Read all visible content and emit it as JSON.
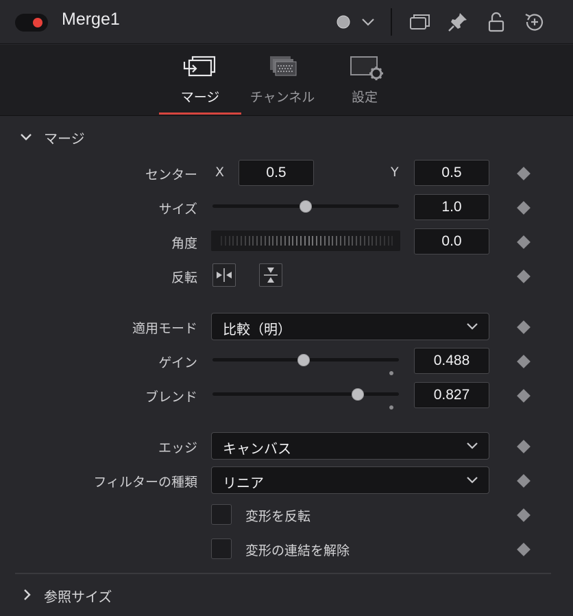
{
  "header": {
    "node_name": "Merge1",
    "enabled_color": "#e8413a",
    "icons": [
      "color-dot-icon",
      "chevron-down-icon",
      "duplicate-icon",
      "pin-icon",
      "lock-icon",
      "reset-icon"
    ]
  },
  "tabs": [
    {
      "label": "マージ",
      "icon": "merge-tab-icon",
      "active": true
    },
    {
      "label": "チャンネル",
      "icon": "channels-tab-icon",
      "active": false
    },
    {
      "label": "設定",
      "icon": "settings-tab-icon",
      "active": false
    }
  ],
  "accent_color": "#d8453f",
  "section": {
    "title": "マージ",
    "center": {
      "label": "センター",
      "x_label": "X",
      "x_value": "0.5",
      "y_label": "Y",
      "y_value": "0.5"
    },
    "size": {
      "label": "サイズ",
      "value": "1.0",
      "slider_fraction": 0.5
    },
    "angle": {
      "label": "角度",
      "value": "0.0"
    },
    "flip": {
      "label": "反転"
    },
    "apply_mode": {
      "label": "適用モード",
      "value": "比較（明）"
    },
    "gain": {
      "label": "ゲイン",
      "value": "0.488",
      "slider_fraction": 0.488
    },
    "blend": {
      "label": "ブレンド",
      "value": "0.827",
      "slider_fraction": 0.827
    },
    "edges": {
      "label": "エッジ",
      "value": "キャンバス"
    },
    "filter": {
      "label": "フィルターの種類",
      "value": "リニア"
    },
    "invert_transform": {
      "label": "変形を反転",
      "checked": false
    },
    "flatten_transform": {
      "label": "変形の連結を解除",
      "checked": false
    }
  },
  "reference_section": {
    "title": "参照サイズ"
  }
}
